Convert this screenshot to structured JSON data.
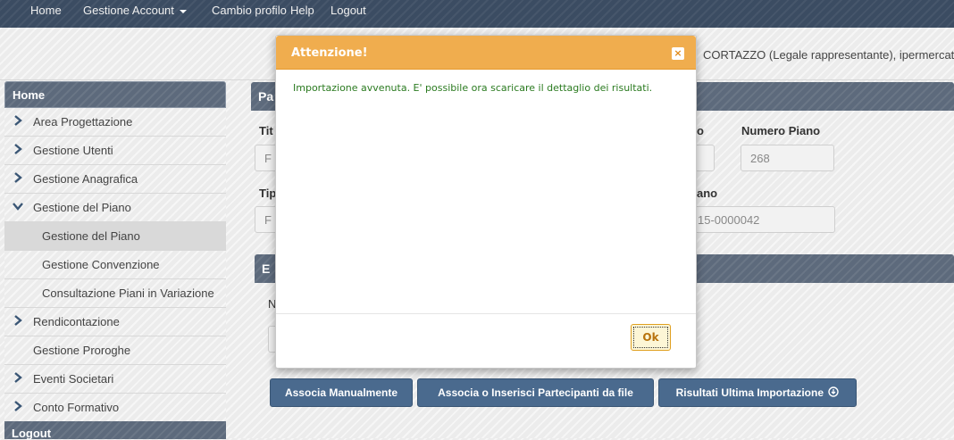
{
  "topnav": {
    "items": [
      "Home",
      "Gestione Account",
      "Cambio profilo",
      "Help",
      "Logout"
    ]
  },
  "userbar": {
    "user_text": "CORTAZZO (Legale rappresentante), ipermercato"
  },
  "sidebar": {
    "header": "Home",
    "items": [
      {
        "label": "Area Progettazione"
      },
      {
        "label": "Gestione Utenti"
      },
      {
        "label": "Gestione Anagrafica"
      },
      {
        "label": "Gestione del Piano"
      },
      {
        "label": "Gestione del Piano"
      },
      {
        "label": "Gestione Convenzione"
      },
      {
        "label": "Consultazione Piani in Variazione"
      },
      {
        "label": "Rendicontazione"
      },
      {
        "label": "Gestione Proroghe"
      },
      {
        "label": "Eventi Societari"
      },
      {
        "label": "Conto Formativo"
      }
    ],
    "footer": "Logout"
  },
  "main": {
    "panel1_title_partial": "Pa",
    "label_titolo_partial": "Tit",
    "input_titolo_partial": "F",
    "label_protocollo_partial": "o",
    "label_numero_piano": "Numero Piano",
    "input_numero_piano": "268",
    "label_tipo_partial": "Tip",
    "input_tipo_partial": "F",
    "label_piano_partial": "ano",
    "input_codice_partial": "15-0000042",
    "panel2_title_partial": "E",
    "label_n_partial": "N"
  },
  "buttons": {
    "associa_manualmente": "Associa Manualmente",
    "associa_da_file": "Associa o Inserisci Partecipanti da file",
    "risultati": "Risultati Ultima Importazione"
  },
  "modal": {
    "title": "Attenzione!",
    "close": "×",
    "message": "Importazione avvenuta. E' possibile ora scaricare il dettaglio dei risultati.",
    "ok": "Ok"
  },
  "colors": {
    "modal_header": "#f0ad4e",
    "success_text": "#2a7a1f",
    "nav_bg": "#3b4c62",
    "button_bg": "#4a6a8e"
  }
}
